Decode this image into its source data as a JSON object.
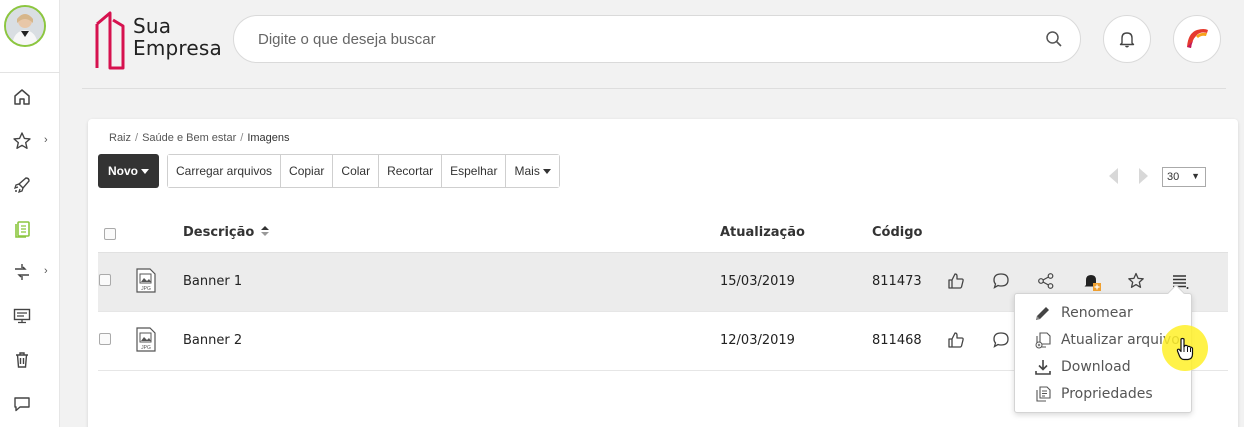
{
  "app": {
    "brand_line1": "Sua",
    "brand_line2": "Empresa",
    "brand_color": "#d6124f"
  },
  "sidebar": {
    "items": [
      {
        "icon": "home-icon"
      },
      {
        "icon": "star-icon",
        "has_arrow": true
      },
      {
        "icon": "rocket-icon"
      },
      {
        "icon": "documents-icon",
        "active": true
      },
      {
        "icon": "workflow-arrows-icon",
        "has_arrow": true
      },
      {
        "icon": "presentation-icon"
      },
      {
        "icon": "trash-icon"
      },
      {
        "icon": "chat-icon"
      }
    ],
    "arrow": "›",
    "active_color": "#8cc63f"
  },
  "search": {
    "placeholder": "Digite o que deseja buscar"
  },
  "breadcrumb": {
    "items": [
      "Raiz",
      "Saúde e Bem estar",
      "Imagens"
    ],
    "separator": "/"
  },
  "toolbar": {
    "new_label": "Novo",
    "buttons": [
      "Carregar arquivos",
      "Copiar",
      "Colar",
      "Recortar",
      "Espelhar",
      "Mais"
    ]
  },
  "pagination": {
    "page_size": "30"
  },
  "table": {
    "columns": {
      "description": "Descrição",
      "updated": "Atualização",
      "code": "Código"
    },
    "rows": [
      {
        "name": "Banner 1",
        "date": "15/03/2019",
        "code": "811473",
        "file_type": "JPG"
      },
      {
        "name": "Banner 2",
        "date": "12/03/2019",
        "code": "811468",
        "file_type": "JPG"
      }
    ]
  },
  "context_menu": {
    "items": [
      {
        "label": "Renomear",
        "icon": "pencil-icon"
      },
      {
        "label": "Atualizar arquivo",
        "icon": "update-file-icon"
      },
      {
        "label": "Download",
        "icon": "download-icon"
      },
      {
        "label": "Propriedades",
        "icon": "properties-icon"
      }
    ]
  },
  "colors": {
    "notification_badge": "#f0a030",
    "cursor_highlight": "#fff028"
  }
}
